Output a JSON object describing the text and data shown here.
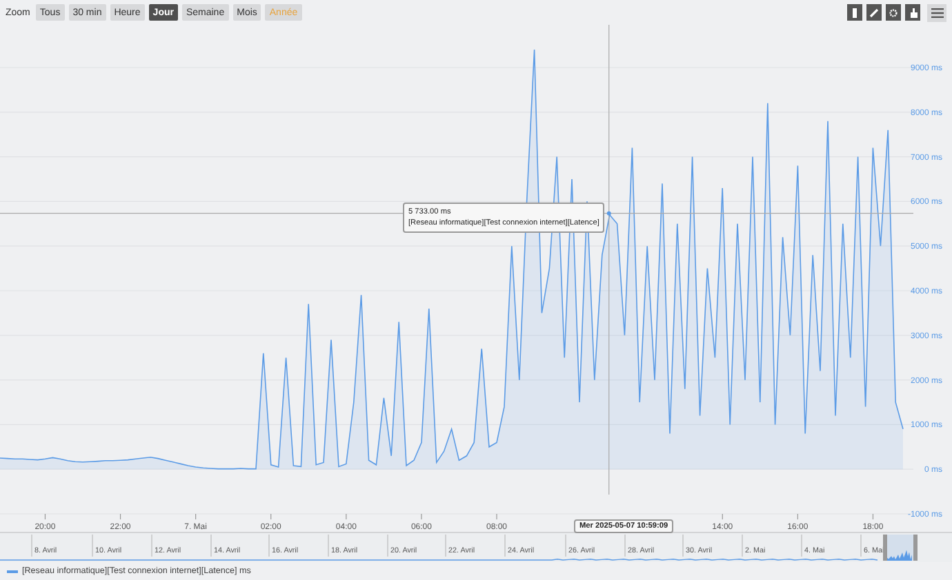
{
  "toolbar": {
    "zoom_label": "Zoom",
    "buttons": [
      {
        "label": "Tous",
        "selected": false,
        "highlighted": false
      },
      {
        "label": "30 min",
        "selected": false,
        "highlighted": false
      },
      {
        "label": "Heure",
        "selected": false,
        "highlighted": false
      },
      {
        "label": "Jour",
        "selected": true,
        "highlighted": false
      },
      {
        "label": "Semaine",
        "selected": false,
        "highlighted": false
      },
      {
        "label": "Mois",
        "selected": false,
        "highlighted": false
      },
      {
        "label": "Année",
        "selected": false,
        "highlighted": true
      }
    ],
    "tools": [
      {
        "kind": "bar"
      },
      {
        "kind": "pencil"
      },
      {
        "kind": "gear"
      },
      {
        "kind": "hand"
      }
    ]
  },
  "chart": {
    "chart_data": {
      "type": "area",
      "grid": true,
      "x": [
        "2025-05-06 18:48",
        "2025-05-06 19:00",
        "2025-05-06 19:12",
        "2025-05-06 19:24",
        "2025-05-06 19:36",
        "2025-05-06 19:48",
        "2025-05-06 20:00",
        "2025-05-06 20:12",
        "2025-05-06 20:24",
        "2025-05-06 20:36",
        "2025-05-06 20:48",
        "2025-05-06 21:00",
        "2025-05-06 21:12",
        "2025-05-06 21:24",
        "2025-05-06 21:36",
        "2025-05-06 21:48",
        "2025-05-06 22:00",
        "2025-05-06 22:12",
        "2025-05-06 22:24",
        "2025-05-06 22:36",
        "2025-05-06 22:48",
        "2025-05-06 23:00",
        "2025-05-06 23:12",
        "2025-05-06 23:24",
        "2025-05-06 23:36",
        "2025-05-06 23:48",
        "2025-05-07 00:00",
        "2025-05-07 00:12",
        "2025-05-07 00:24",
        "2025-05-07 00:36",
        "2025-05-07 00:48",
        "2025-05-07 01:00",
        "2025-05-07 01:12",
        "2025-05-07 01:24",
        "2025-05-07 01:36",
        "2025-05-07 01:48",
        "2025-05-07 02:00",
        "2025-05-07 02:12",
        "2025-05-07 02:24",
        "2025-05-07 02:36",
        "2025-05-07 02:48",
        "2025-05-07 03:00",
        "2025-05-07 03:12",
        "2025-05-07 03:24",
        "2025-05-07 03:36",
        "2025-05-07 03:48",
        "2025-05-07 04:00",
        "2025-05-07 04:12",
        "2025-05-07 04:24",
        "2025-05-07 04:36",
        "2025-05-07 04:48",
        "2025-05-07 05:00",
        "2025-05-07 05:12",
        "2025-05-07 05:24",
        "2025-05-07 05:36",
        "2025-05-07 05:48",
        "2025-05-07 06:00",
        "2025-05-07 06:12",
        "2025-05-07 06:24",
        "2025-05-07 06:36",
        "2025-05-07 06:48",
        "2025-05-07 07:00",
        "2025-05-07 07:12",
        "2025-05-07 07:24",
        "2025-05-07 07:36",
        "2025-05-07 07:48",
        "2025-05-07 08:00",
        "2025-05-07 08:12",
        "2025-05-07 08:24",
        "2025-05-07 08:36",
        "2025-05-07 08:48",
        "2025-05-07 09:00",
        "2025-05-07 09:12",
        "2025-05-07 09:24",
        "2025-05-07 09:36",
        "2025-05-07 09:48",
        "2025-05-07 10:00",
        "2025-05-07 10:12",
        "2025-05-07 10:24",
        "2025-05-07 10:36",
        "2025-05-07 10:48",
        "2025-05-07 11:00",
        "2025-05-07 11:12",
        "2025-05-07 11:24",
        "2025-05-07 11:36",
        "2025-05-07 11:48",
        "2025-05-07 12:00",
        "2025-05-07 12:12",
        "2025-05-07 12:24",
        "2025-05-07 12:36",
        "2025-05-07 12:48",
        "2025-05-07 13:00",
        "2025-05-07 13:12",
        "2025-05-07 13:24",
        "2025-05-07 13:36",
        "2025-05-07 13:48",
        "2025-05-07 14:00",
        "2025-05-07 14:12",
        "2025-05-07 14:24",
        "2025-05-07 14:36",
        "2025-05-07 14:48",
        "2025-05-07 15:00",
        "2025-05-07 15:12",
        "2025-05-07 15:24",
        "2025-05-07 15:36",
        "2025-05-07 15:48",
        "2025-05-07 16:00",
        "2025-05-07 16:12",
        "2025-05-07 16:24",
        "2025-05-07 16:36",
        "2025-05-07 16:48",
        "2025-05-07 17:00",
        "2025-05-07 17:12",
        "2025-05-07 17:24",
        "2025-05-07 17:36",
        "2025-05-07 17:48",
        "2025-05-07 18:00",
        "2025-05-07 18:12",
        "2025-05-07 18:24",
        "2025-05-07 18:36",
        "2025-05-07 18:48"
      ],
      "xlim": [
        "2025-05-06 18:48",
        "2025-05-07 19:00"
      ],
      "ylim": [
        -1000,
        10000
      ],
      "ref_lines": [
        {
          "axis": "y",
          "value": 5733
        },
        {
          "axis": "x",
          "value": "2025-05-07 10:59"
        }
      ],
      "series": [
        {
          "name": "[Reseau informatique][Test connexion internet][Latence] ms",
          "color": "#5b9be6",
          "values": [
            250,
            240,
            230,
            230,
            220,
            210,
            230,
            260,
            230,
            190,
            170,
            160,
            170,
            180,
            190,
            190,
            200,
            210,
            230,
            250,
            270,
            240,
            200,
            160,
            120,
            80,
            50,
            30,
            20,
            10,
            10,
            10,
            20,
            10,
            10,
            2600,
            100,
            50,
            2500,
            80,
            60,
            3700,
            100,
            150,
            2900,
            60,
            120,
            1500,
            3900,
            200,
            100,
            1600,
            300,
            3300,
            80,
            200,
            600,
            3600,
            150,
            400,
            900,
            200,
            300,
            600,
            2700,
            500,
            600,
            1400,
            5000,
            2000,
            6000,
            9400,
            3500,
            4500,
            7000,
            2500,
            6500,
            1500,
            6000,
            2000,
            4800,
            5700,
            5500,
            3000,
            7200,
            1500,
            5000,
            2000,
            6400,
            800,
            5500,
            1800,
            7000,
            1200,
            4500,
            2500,
            6300,
            1000,
            5500,
            2000,
            7000,
            1500,
            8200,
            1000,
            5200,
            3000,
            6800,
            800,
            4800,
            2200,
            7800,
            1200,
            5500,
            2500,
            7000,
            1400,
            7200,
            5000,
            7600,
            1500,
            900
          ]
        }
      ],
      "yticks": [
        {
          "value": -1000,
          "label": "-1000 ms"
        },
        {
          "value": 0,
          "label": "0 ms"
        },
        {
          "value": 1000,
          "label": "1000 ms"
        },
        {
          "value": 2000,
          "label": "2000 ms"
        },
        {
          "value": 3000,
          "label": "3000 ms"
        },
        {
          "value": 4000,
          "label": "4000 ms"
        },
        {
          "value": 5000,
          "label": "5000 ms"
        },
        {
          "value": 6000,
          "label": "6000 ms"
        },
        {
          "value": 7000,
          "label": "7000 ms"
        },
        {
          "value": 8000,
          "label": "8000 ms"
        },
        {
          "value": 9000,
          "label": "9000 ms"
        }
      ],
      "xticks": [
        {
          "value": "2025-05-06 20:00",
          "label": "20:00"
        },
        {
          "value": "2025-05-06 22:00",
          "label": "22:00"
        },
        {
          "value": "2025-05-07 00:00",
          "label": "7. Mai"
        },
        {
          "value": "2025-05-07 02:00",
          "label": "02:00"
        },
        {
          "value": "2025-05-07 04:00",
          "label": "04:00"
        },
        {
          "value": "2025-05-07 06:00",
          "label": "06:00"
        },
        {
          "value": "2025-05-07 08:00",
          "label": "08:00"
        },
        {
          "value": "2025-05-07 14:00",
          "label": "14:00"
        },
        {
          "value": "2025-05-07 16:00",
          "label": "16:00"
        },
        {
          "value": "2025-05-07 18:00",
          "label": "18:00"
        }
      ]
    },
    "tooltip": {
      "value": "5 733.00 ms",
      "series": "[Reseau informatique][Test connexion internet][Latence]"
    },
    "crosshair_label": "Mer 2025-05-07 10:59:09"
  },
  "navigator": {
    "labels": [
      "8. Avril",
      "10. Avril",
      "12. Avril",
      "14. Avril",
      "16. Avril",
      "18. Avril",
      "20. Avril",
      "22. Avril",
      "24. Avril",
      "26. Avril",
      "28. Avril",
      "30. Avril",
      "2. Mai",
      "4. Mai",
      "6. Mai"
    ]
  }
}
